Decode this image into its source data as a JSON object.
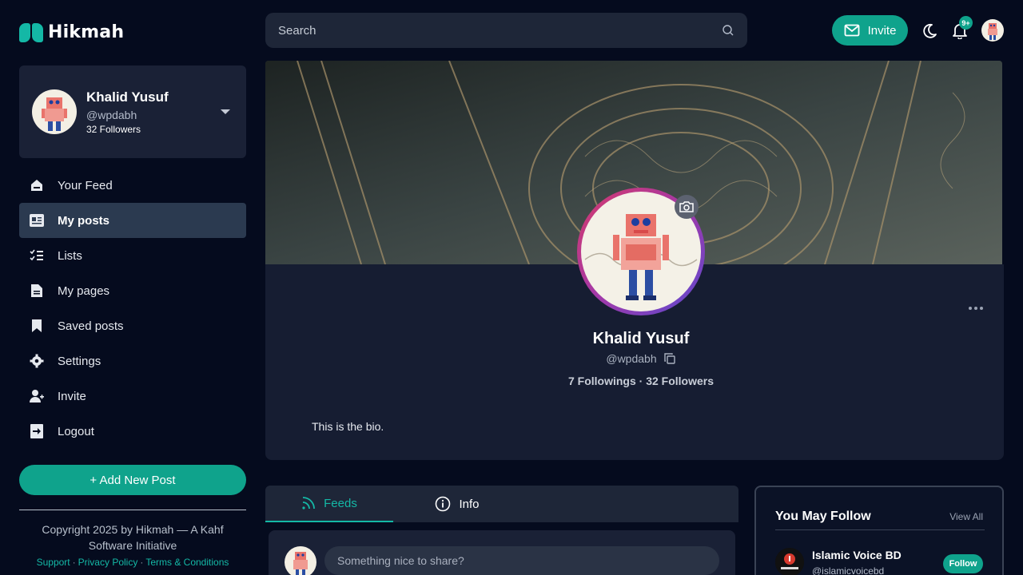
{
  "brand": {
    "name": "Hikmah"
  },
  "search": {
    "placeholder": "Search"
  },
  "header": {
    "invite_label": "Invite",
    "notification_count": "9+"
  },
  "sidebar": {
    "profile": {
      "name": "Khalid Yusuf",
      "handle": "@wpdabh",
      "followers": "32 Followers"
    },
    "items": [
      {
        "label": "Your Feed",
        "icon": "home-icon"
      },
      {
        "label": "My posts",
        "icon": "posts-icon",
        "active": true
      },
      {
        "label": "Lists",
        "icon": "list-icon"
      },
      {
        "label": "My pages",
        "icon": "page-icon"
      },
      {
        "label": "Saved posts",
        "icon": "bookmark-icon"
      },
      {
        "label": "Settings",
        "icon": "gear-icon"
      },
      {
        "label": "Invite",
        "icon": "add-user-icon"
      },
      {
        "label": "Logout",
        "icon": "logout-icon"
      }
    ],
    "add_post_label": "+ Add New Post",
    "copyright": "Copyright 2025 by Hikmah — A Kahf Software Initiative",
    "links": [
      "Support",
      "Privacy Policy",
      "Terms & Conditions"
    ]
  },
  "profile": {
    "name": "Khalid Yusuf",
    "handle": "@wpdabh",
    "stats": "7 Followings · 32 Followers",
    "bio": "This is the bio."
  },
  "tabs": [
    {
      "label": "Feeds",
      "icon": "rss-icon",
      "active": true
    },
    {
      "label": "Info",
      "icon": "info-icon"
    }
  ],
  "composer": {
    "placeholder": "Something nice to share?"
  },
  "suggestions": {
    "title": "You May Follow",
    "view_all": "View All",
    "items": [
      {
        "name": "Islamic Voice BD",
        "handle": "@islamicvoicebd",
        "button": "Follow"
      }
    ]
  },
  "colors": {
    "accent": "#0fa38c",
    "background": "#050b1e",
    "card": "#161d32"
  }
}
